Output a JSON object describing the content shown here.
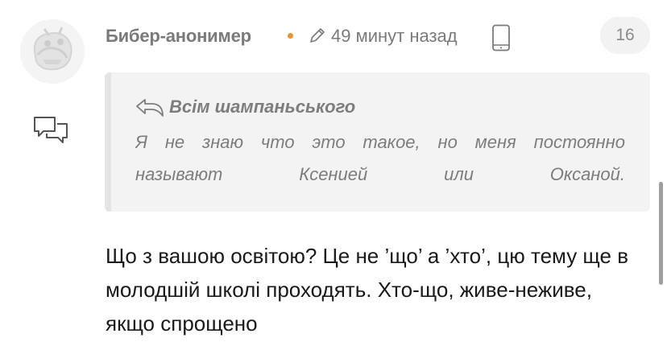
{
  "comment": {
    "author": "Бибер-анонимер",
    "time": "49 минут назад",
    "votes": "16",
    "body": "Що з вашою освітою? Це не ’що’ а ’хто’, цю тему ще в молодшій школі проходять. Хто-що, живе-неживе, якщо спрощено"
  },
  "quote": {
    "author": "Всім шампаньського",
    "text": "Я не знаю что это такое, но меня постоянно называют Ксенией или Оксаной."
  },
  "icons": {
    "avatar": "robot-avatar",
    "reply": "chat-bubbles-icon",
    "edit": "pencil-icon",
    "device": "mobile-phone-icon",
    "quote": "reply-arrow-icon"
  },
  "colors": {
    "online_dot": "#f0922e",
    "meta_text": "#7a7a7a",
    "quote_bg": "#f3f3f3"
  }
}
